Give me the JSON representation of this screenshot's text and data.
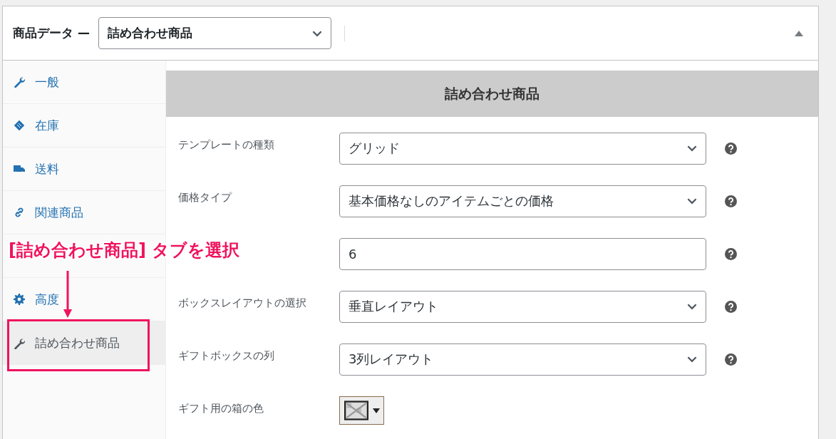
{
  "header": {
    "title": "商品データ —",
    "product_type": "詰め合わせ商品"
  },
  "sidebar": {
    "items": [
      {
        "kind": "tab",
        "label": "一般",
        "selected": false
      },
      {
        "kind": "tab",
        "label": "在庫",
        "selected": false
      },
      {
        "kind": "tab",
        "label": "送料",
        "selected": false
      },
      {
        "kind": "tab",
        "label": "関連商品",
        "selected": false
      },
      {
        "kind": "covered"
      },
      {
        "kind": "tab",
        "label": "高度",
        "selected": false
      },
      {
        "kind": "tab",
        "label": "詰め合わせ商品",
        "selected": true
      }
    ]
  },
  "panel": {
    "heading": "詰め合わせ商品",
    "fields": [
      {
        "kind": "select",
        "label": "テンプレートの種類",
        "value": "グリッド"
      },
      {
        "kind": "select",
        "label": "価格タイプ",
        "value": "基本価格なしのアイテムごとの価格"
      },
      {
        "kind": "text",
        "value": "6"
      },
      {
        "kind": "select",
        "label": "ボックスレイアウトの選択",
        "value": "垂直レイアウト"
      },
      {
        "kind": "select",
        "label": "ギフトボックスの列",
        "value": "3列レイアウト"
      },
      {
        "kind": "color",
        "label": "ギフト用の箱の色"
      }
    ]
  },
  "annotation": {
    "text": "[詰め合わせ商品] タブを選択"
  }
}
